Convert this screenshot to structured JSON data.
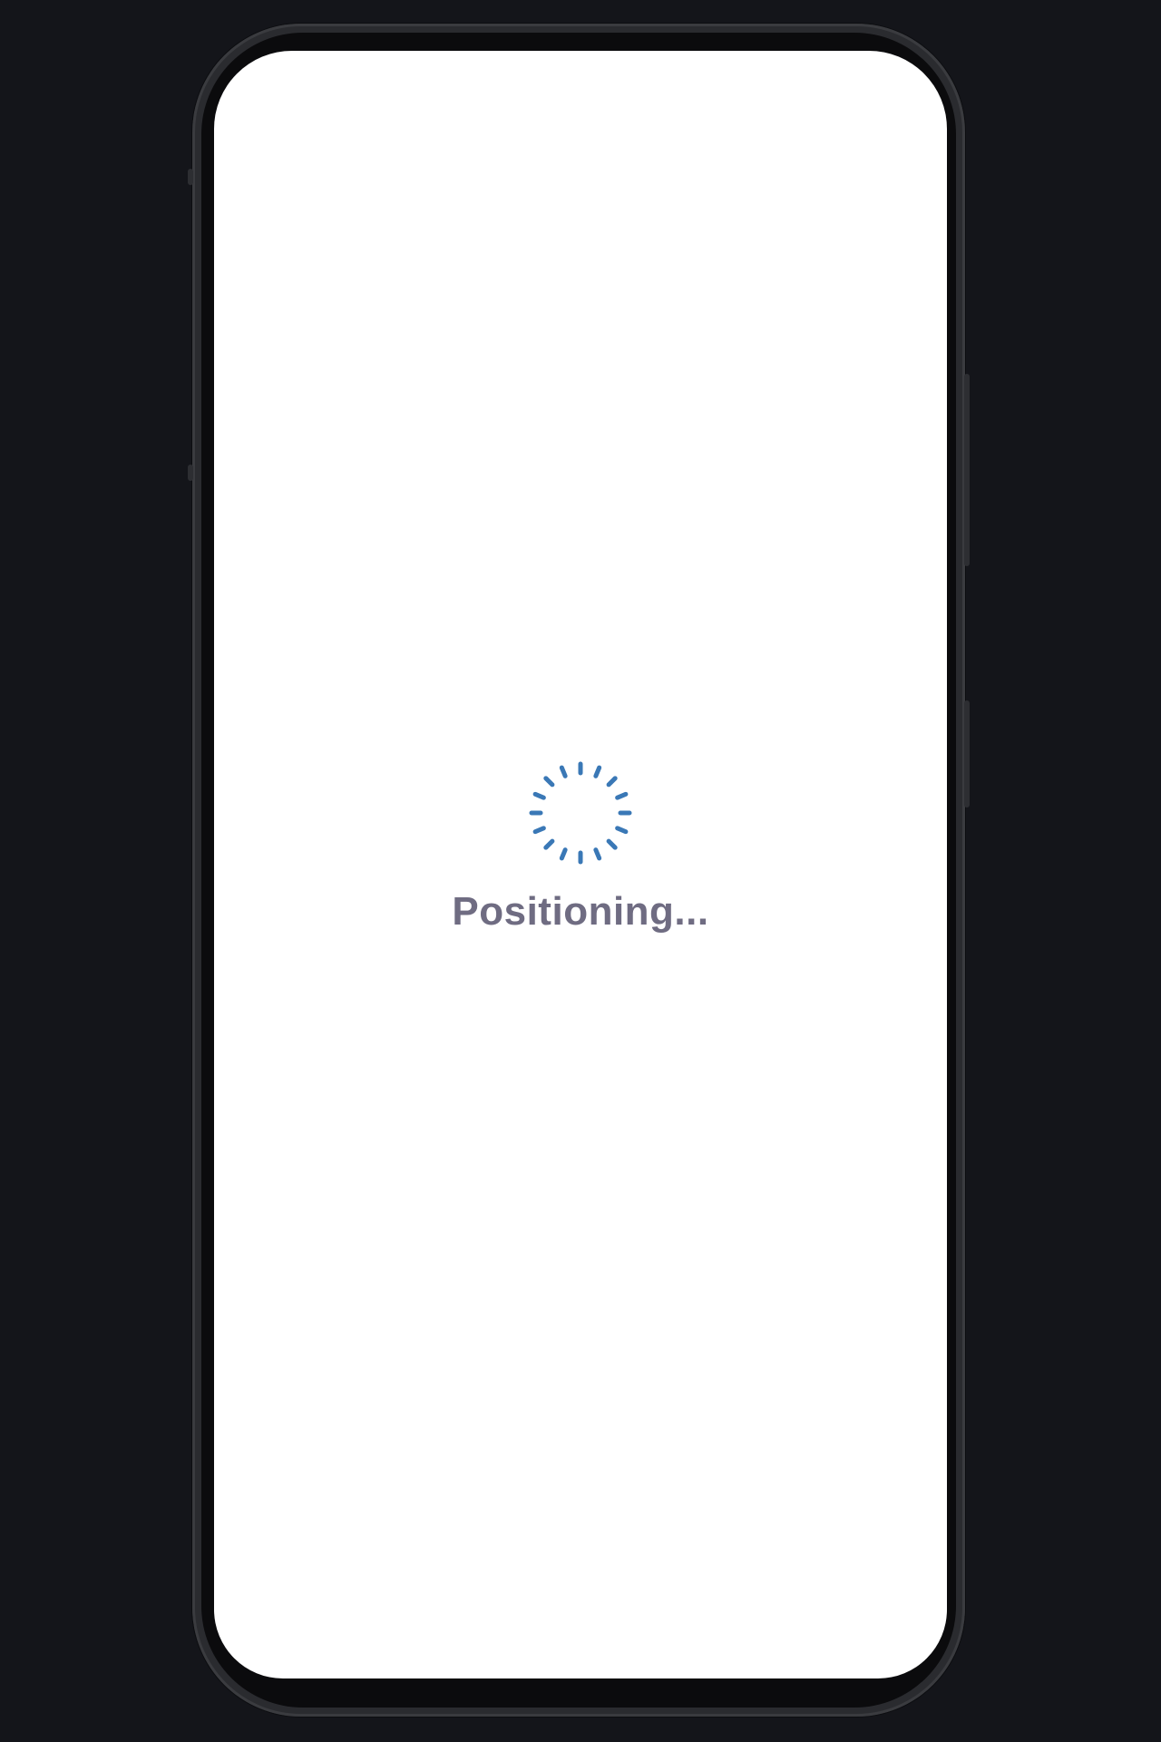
{
  "loading": {
    "text": "Positioning...",
    "icon": "spinner-icon",
    "accent_color": "#3a78b6",
    "text_color": "#6f6c82"
  }
}
